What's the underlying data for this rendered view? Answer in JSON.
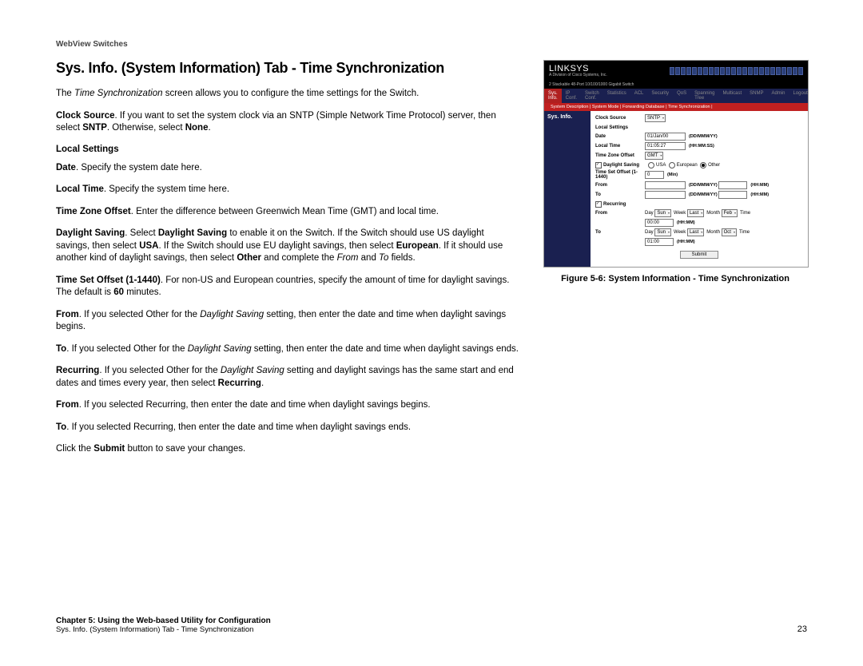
{
  "header": {
    "title": "WebView Switches"
  },
  "main": {
    "title": "Sys. Info. (System Information) Tab - Time Synchronization",
    "intro_pre": "The ",
    "intro_em": "Time Synchronization",
    "intro_post": " screen allows you to configure the time settings for the Switch.",
    "clock_source": {
      "label": "Clock Source",
      "text1": ". If you want to set the system clock via an SNTP (Simple Network Time Protocol) server, then select ",
      "b1": "SNTP",
      "text2": ". Otherwise, select ",
      "b2": "None",
      "text3": "."
    },
    "local_settings_h": "Local Settings",
    "date": {
      "label": "Date",
      "text": ". Specify the system date here."
    },
    "local_time": {
      "label": "Local Time",
      "text": ". Specify the system time here."
    },
    "tzo": {
      "label": "Time Zone Offset",
      "text": ". Enter the difference between Greenwich Mean Time (GMT) and local time."
    },
    "ds": {
      "label": "Daylight Saving",
      "t1": ". Select ",
      "b1": "Daylight Saving",
      "t2": " to enable it on the Switch. If the Switch should use US daylight savings, then select ",
      "b2": "USA",
      "t3": ". If the Switch should use EU daylight savings, then select ",
      "b3": "European",
      "t4": ". If it should use another kind of daylight savings, then select ",
      "b4": "Other",
      "t5": " and complete the ",
      "i1": "From",
      "t6": " and ",
      "i2": "To",
      "t7": " fields."
    },
    "tso": {
      "label": "Time Set Offset (1-1440)",
      "t1": ". For non-US and European countries, specify the amount of time for daylight savings. The default is ",
      "b1": "60",
      "t2": " minutes."
    },
    "from": {
      "label": "From",
      "t1": ". If you selected Other for the ",
      "i1": "Daylight Saving",
      "t2": " setting, then enter the date and time when daylight savings begins."
    },
    "to": {
      "label": "To",
      "t1": ". If you selected Other for the ",
      "i1": "Daylight Saving",
      "t2": " setting, then enter the date and time when daylight savings ends."
    },
    "recurring": {
      "label": "Recurring",
      "t1": ". If you selected Other for the ",
      "i1": "Daylight Saving",
      "t2": " setting and daylight savings has the same start and end dates and times every year, then select ",
      "b1": "Recurring",
      "t3": "."
    },
    "from2": {
      "label": "From",
      "text": ". If you selected Recurring, then enter the date and time when daylight savings begins."
    },
    "to2": {
      "label": "To",
      "text": ". If you selected Recurring, then enter the date and time when daylight savings ends."
    },
    "submit_line": {
      "t1": "Click the ",
      "b1": "Submit",
      "t2": " button to save your changes."
    }
  },
  "figure": {
    "caption": "Figure 5-6: System Information - Time Synchronization",
    "logo": "LINKSYS",
    "logo_sub": "A Division of Cisco Systems, Inc.",
    "device": "2 Stackable 48-Port 10/100/1000 Gigabit Switch",
    "tabs": [
      "Sys. Info.",
      "IP Conf.",
      "Switch Conf.",
      "Statistics",
      "ACL",
      "Security",
      "QoS",
      "Spanning Tree",
      "Multicast",
      "SNMP",
      "Admin",
      "Logout"
    ],
    "subtabs": "System Description  |  System Mode  |  Forwarding Database  |  Time Synchronization  |",
    "sidebar": "Sys. Info.",
    "form": {
      "clock_source": {
        "label": "Clock Source",
        "value": "SNTP"
      },
      "local_settings": "Local Settings",
      "date": {
        "label": "Date",
        "value": "01/Jan/00",
        "hint": "(DD/MMM/YY)"
      },
      "local_time": {
        "label": "Local Time",
        "value": "01:05:27",
        "hint": "(HH:MM:SS)"
      },
      "tzo": {
        "label": "Time Zone Offset",
        "value": "GMT"
      },
      "daylight": {
        "label": "Daylight Saving",
        "opt1": "USA",
        "opt2": "European",
        "opt3": "Other"
      },
      "tso": {
        "label": "Time Set Offset (1-1440)",
        "value": "0",
        "suffix": "(Min)"
      },
      "from": {
        "label": "From",
        "hint1": "(DD/MMM/YY)",
        "hint2": "(HH:MM)"
      },
      "to": {
        "label": "To",
        "hint1": "(DD/MMM/YY)",
        "hint2": "(HH:MM)"
      },
      "recurring": {
        "label": "Recurring"
      },
      "rfrom": {
        "label": "From",
        "day_l": "Day",
        "day": "Sun",
        "week_l": "Week",
        "week": "Last",
        "month_l": "Month",
        "month": "Feb",
        "time_l": "Time",
        "time": "00:00",
        "time_hint": "(HH:MM)"
      },
      "rto": {
        "label": "To",
        "day_l": "Day",
        "day": "Sun",
        "week_l": "Week",
        "week": "Last",
        "month_l": "Month",
        "month": "Oct",
        "time_l": "Time",
        "time": "01:00",
        "time_hint": "(HH:MM)"
      },
      "submit": "Submit"
    }
  },
  "footer": {
    "chapter": "Chapter 5: Using the Web-based Utility for Configuration",
    "section": "Sys. Info. (System Information) Tab - Time Synchronization",
    "page": "23"
  }
}
